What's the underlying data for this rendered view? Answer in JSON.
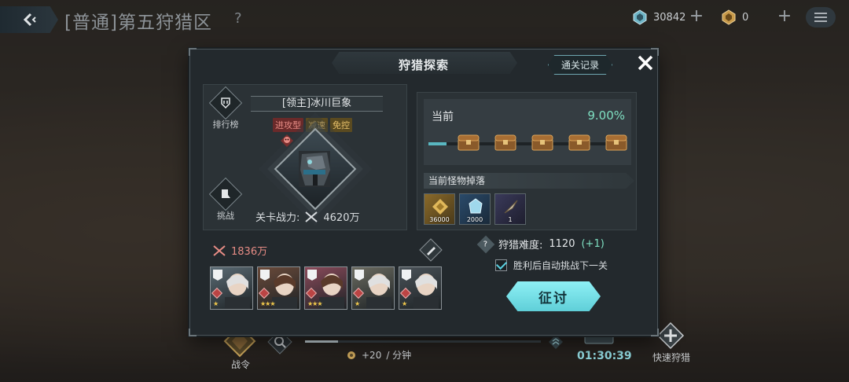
{
  "header": {
    "title": "[普通]第五狩猎区",
    "help_glyph": "?",
    "currency1_value": "30842",
    "currency2_value": "0"
  },
  "modal": {
    "title": "狩猎探索",
    "record_button": "通关记录",
    "boss": {
      "name": "[领主]冰川巨象",
      "tags": [
        "进攻型",
        "减速",
        "免控"
      ],
      "rank_label": "排行榜",
      "challenge_label": "挑战",
      "power_label": "关卡战力:",
      "power_value": "4620万"
    },
    "progress": {
      "current_label": "当前",
      "percent": "9.00%",
      "fill_fraction": 0.09,
      "chest_count": 5
    },
    "drops": {
      "header": "当前怪物掉落",
      "items": [
        {
          "icon": "gold-coins-icon",
          "qty": "36000"
        },
        {
          "icon": "ice-crystal-icon",
          "qty": "2000"
        },
        {
          "icon": "drill-part-icon",
          "qty": "1"
        }
      ]
    },
    "team": {
      "power": "1836万",
      "members": [
        {
          "name": "member-1",
          "stars": "★",
          "color": "#5b6b74"
        },
        {
          "name": "member-2",
          "stars": "★★★",
          "color": "#6a4a3a"
        },
        {
          "name": "member-3",
          "stars": "★★★",
          "color": "#8a4a5a"
        },
        {
          "name": "member-4",
          "stars": "★",
          "color": "#6b6b60"
        },
        {
          "name": "member-5",
          "stars": "★",
          "color": "#4a5258"
        }
      ]
    },
    "difficulty": {
      "label": "狩猎难度:",
      "value": "1120",
      "delta": "(+1)"
    },
    "auto_next_label": "胜利后自动挑战下一关",
    "go_button": "征讨"
  },
  "bottom": {
    "battle_pass_label": "战令",
    "rate_value": "+20",
    "rate_unit": "/ 分钟",
    "timer": "01:30:39",
    "quick_hunt_label": "快速狩猎"
  },
  "colors": {
    "accent": "#5fcfd8",
    "positive": "#7fe0c2",
    "danger": "#e78c85"
  }
}
